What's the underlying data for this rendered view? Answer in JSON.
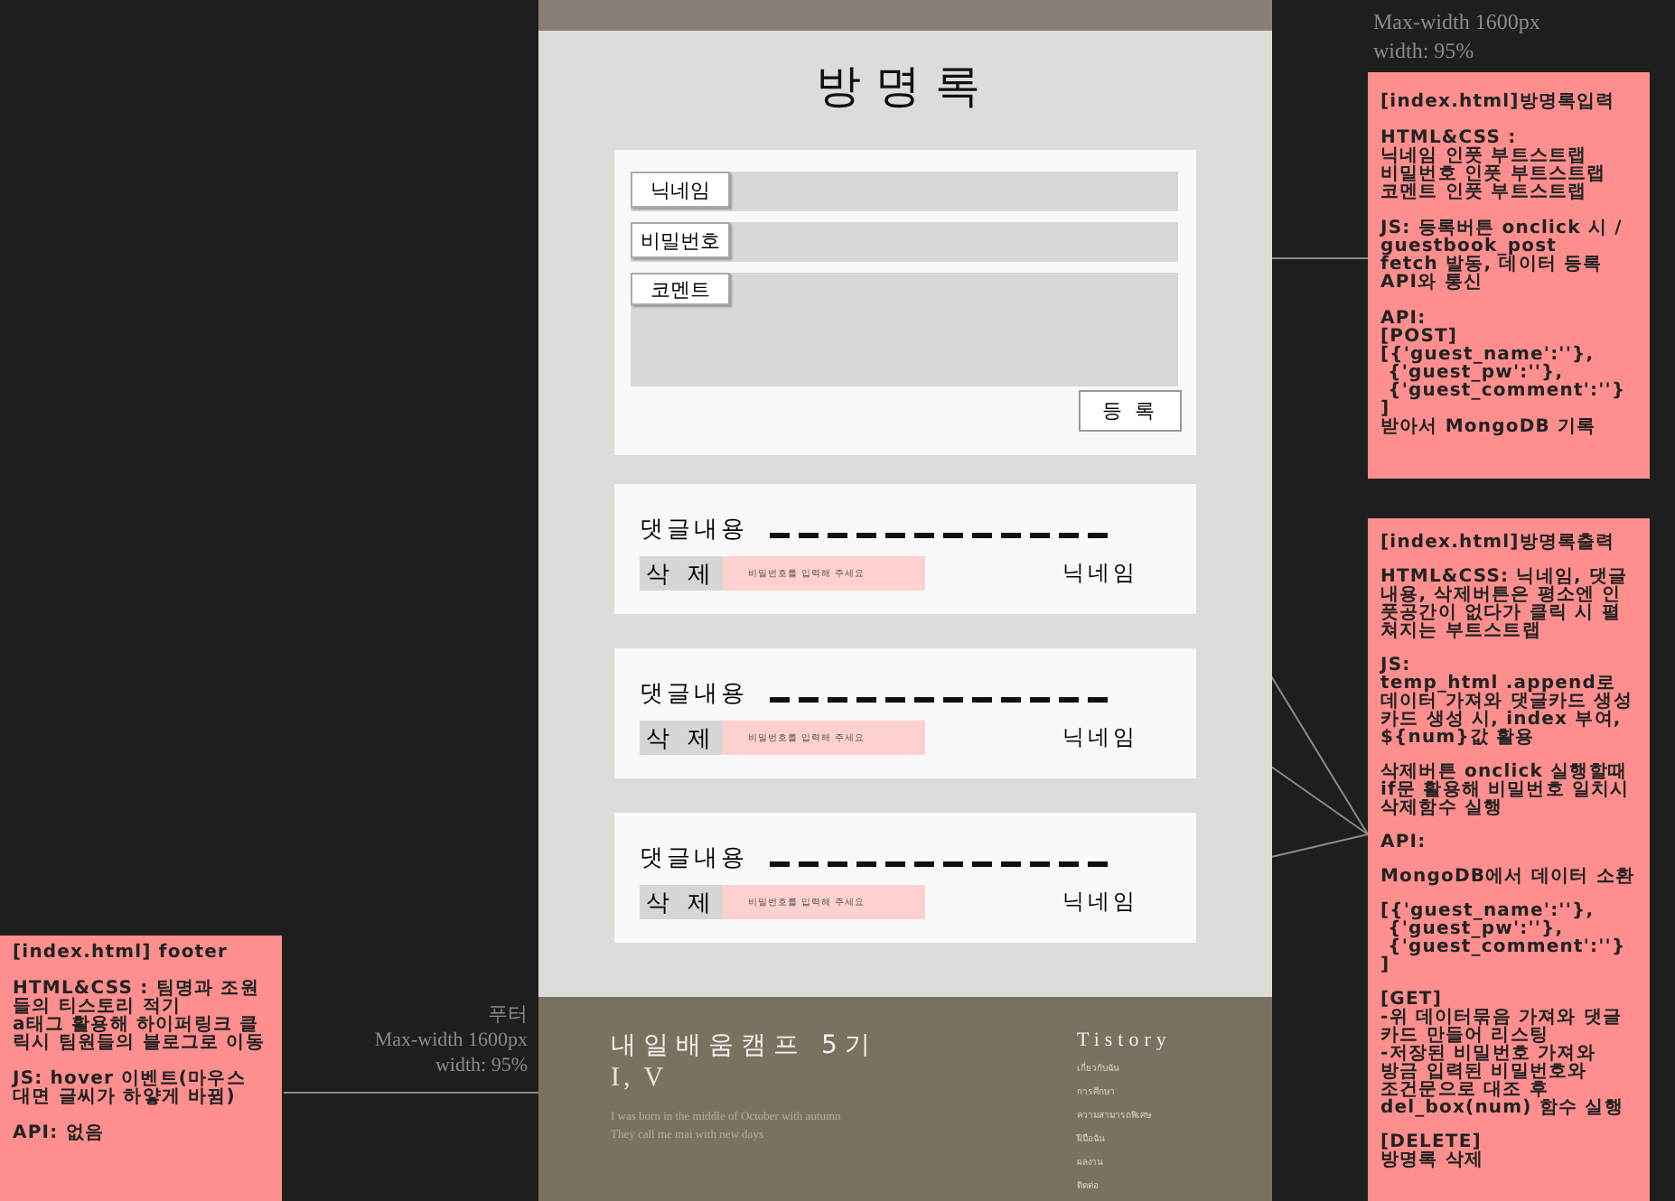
{
  "top_note": {
    "lines": [
      "Max-width 1600px",
      "width: 95%"
    ]
  },
  "footer_note": {
    "lines": [
      "푸터",
      "Max-width 1600px",
      "width: 95%"
    ]
  },
  "annotations": [
    {
      "paragraphs": [
        "[index.html]방명록입력",
        "HTML&CSS :\n닉네임 인풋 부트스트랩\n비밀번호 인풋 부트스트랩\n코멘트 인풋 부트스트랩",
        "JS: 등록버튼 onclick 시 /\nguestbook_post\nfetch 발동, 데이터 등록\nAPI와 통신",
        "API:\n[POST]\n[{'guest_name':''},\n {'guest_pw':''},\n {'guest_comment':''}\n]\n받아서 MongoDB 기록"
      ]
    },
    {
      "paragraphs": [
        "[index.html]방명록출력",
        "HTML&CSS: 닉네임, 댓글\n내용, 삭제버튼은 평소엔 인\n풋공간이 없다가 클릭 시 펼\n쳐지는 부트스트랩",
        "JS:\ntemp_html .append로\n데이터 가져와 댓글카드 생성\n카드 생성 시, index 부여,\n${num}값 활용",
        "삭제버튼 onclick 실행할때\nif문 활용해 비밀번호 일치시\n삭제함수 실행",
        "API:",
        "MongoDB에서 데이터 소환",
        "[{'guest_name':''},\n {'guest_pw':''},\n {'guest_comment':''}\n]",
        "[GET]\n-위 데이터묶음 가져와 댓글\n카드 만들어 리스팅\n-저장된 비밀번호 가져와\n방금 입력된 비밀번호와\n조건문으로 대조 후\ndel_box(num) 함수 실행",
        "[DELETE]\n방명록 삭제"
      ]
    },
    {
      "paragraphs": [
        "[index.html] footer",
        "HTML&CSS : 팀명과 조원\n들의 티스토리 적기\na태그 활용해 하이퍼링크 클\n릭시 팀원들의 블로그로 이동",
        "JS: hover 이벤트(마우스\n대면 글씨가 하얗게 바뀜)",
        "API: 없음"
      ]
    }
  ],
  "guestbook": {
    "title": "방명록",
    "fields": [
      {
        "label": "닉네임",
        "kind": "input"
      },
      {
        "label": "비밀번호",
        "kind": "input"
      },
      {
        "label": "코멘트",
        "kind": "textarea"
      }
    ],
    "submit": "등 록",
    "cards": [
      {
        "comment": "댓글내용",
        "delete": "삭 제",
        "placeholder": "비밀번호를 입력해 주세요",
        "nickname": "닉네임"
      },
      {
        "comment": "댓글내용",
        "delete": "삭 제",
        "placeholder": "비밀번호를 입력해 주세요",
        "nickname": "닉네임"
      },
      {
        "comment": "댓글내용",
        "delete": "삭 제",
        "placeholder": "비밀번호를 입력해 주세요",
        "nickname": "닉네임"
      }
    ]
  },
  "footer": {
    "title": "내일배움캠프 5기",
    "subtitle": "I, V",
    "text": "I was born in the middle of October with autumn They call me mai with new days",
    "links_title": "Tistory",
    "links": [
      "เกี่ยวกับฉัน",
      "การศึกษา",
      "ความสามารถพิเศษ",
      "ฝีมือฉัน",
      "ผลงาน",
      "ติดต่อ"
    ]
  }
}
